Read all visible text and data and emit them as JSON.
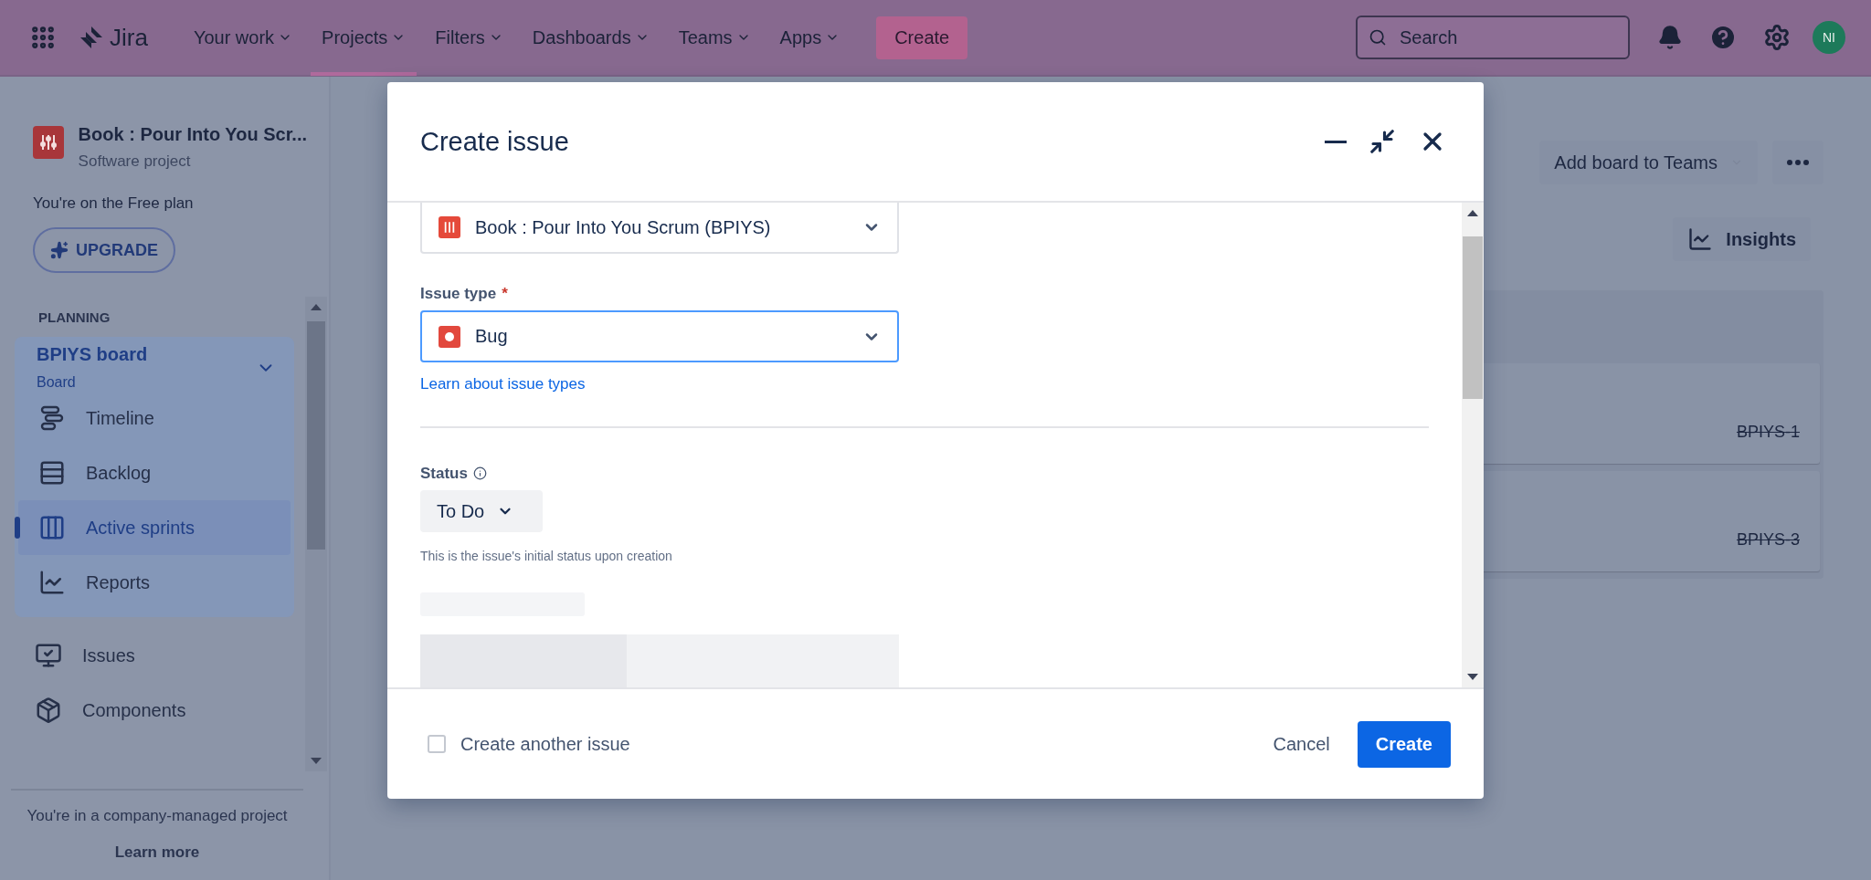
{
  "top_nav": {
    "product": "Jira",
    "items": [
      {
        "label": "Your work",
        "selected": false
      },
      {
        "label": "Projects",
        "selected": true
      },
      {
        "label": "Filters",
        "selected": false
      },
      {
        "label": "Dashboards",
        "selected": false
      },
      {
        "label": "Teams",
        "selected": false
      },
      {
        "label": "Apps",
        "selected": false
      }
    ],
    "create_button": "Create",
    "search": {
      "placeholder": "Search"
    },
    "avatar": "NI"
  },
  "sidebar": {
    "project": {
      "name": "Book : Pour Into You Scr...",
      "type": "Software project"
    },
    "plan_note": "You're on the Free plan",
    "upgrade": "UPGRADE",
    "section": "PLANNING",
    "board": {
      "name": "BPIYS board",
      "type": "Board",
      "expanded": true,
      "items": [
        {
          "label": "Timeline",
          "kind": "timeline",
          "selected": false
        },
        {
          "label": "Backlog",
          "kind": "backlog",
          "selected": false
        },
        {
          "label": "Active sprints",
          "kind": "sprints",
          "selected": true
        },
        {
          "label": "Reports",
          "kind": "reports",
          "selected": false
        }
      ]
    },
    "items": [
      {
        "label": "Issues",
        "kind": "issues",
        "selected": false
      },
      {
        "label": "Components",
        "kind": "components",
        "selected": false
      }
    ],
    "footer": {
      "note": "You're in a company-managed project",
      "link": "Learn more"
    }
  },
  "board": {
    "add_to_teams": "Add board to Teams",
    "insights": "Insights",
    "cards": [
      {
        "key": "BPIYS-1",
        "done": true
      },
      {
        "key": "BPIYS-3",
        "done": true
      }
    ]
  },
  "dialog": {
    "title": "Create issue",
    "project_field": {
      "value": "Book : Pour Into You Scrum (BPIYS)"
    },
    "issue_type": {
      "label": "Issue type",
      "required_mark": "*",
      "value": "Bug",
      "focused": true
    },
    "issue_type_link": "Learn about issue types",
    "status": {
      "label": "Status",
      "value": "To Do",
      "helper": "This is the issue's initial status upon creation"
    },
    "footer": {
      "create_another": {
        "label": "Create another issue",
        "checked": false
      },
      "cancel": "Cancel",
      "create": "Create"
    }
  }
}
